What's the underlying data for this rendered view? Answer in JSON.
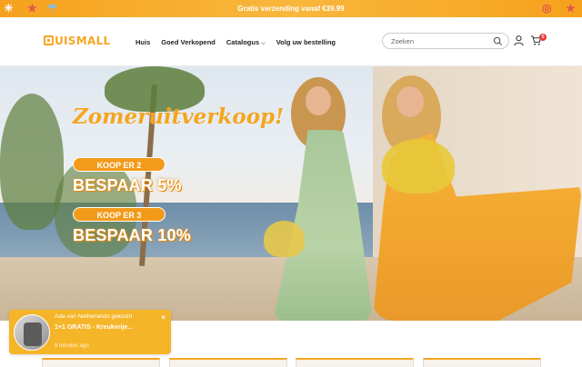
{
  "announcement": {
    "text": "Gratis verzending vanaf €39.99"
  },
  "header": {
    "logo": {
      "mark": "H",
      "text": "UISMALL"
    },
    "nav": [
      {
        "label": "Huis"
      },
      {
        "label": "Goed Verkopend"
      },
      {
        "label": "Catalogus"
      },
      {
        "label": "Volg uw bestelling"
      }
    ],
    "search": {
      "placeholder": "Zoeken"
    },
    "cart_count": "0",
    "icons": [
      "search-icon",
      "user-icon",
      "cart-icon"
    ]
  },
  "hero": {
    "title": "Zomeruitverkoop!",
    "offers": [
      {
        "pill": "KOOP ER 2",
        "save": "BESPAAR 5%"
      },
      {
        "pill": "KOOP ER 3",
        "save": "BESPAAR 10%"
      }
    ]
  },
  "toast": {
    "line1": "Ada van Netherlands gekocht",
    "line2": "1+1 GRATIS - Kreukvrije...",
    "time": "8 minutes ago",
    "close": "×"
  },
  "colors": {
    "accent": "#f5a623",
    "badge": "#e53935"
  }
}
